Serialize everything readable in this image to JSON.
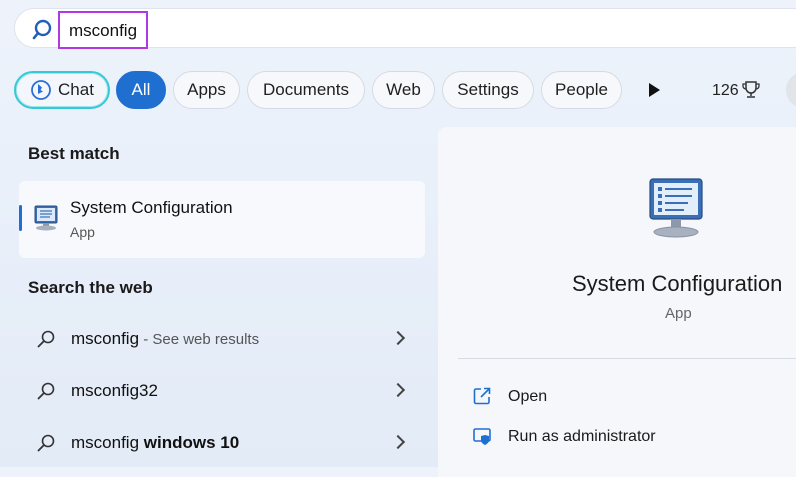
{
  "search": {
    "query": "msconfig"
  },
  "filters": {
    "chat": "Chat",
    "tabs": [
      "All",
      "Apps",
      "Documents",
      "Web",
      "Settings",
      "People"
    ],
    "active_tab": "All",
    "points": "126"
  },
  "best_match": {
    "heading": "Best match",
    "title": "System Configuration",
    "subtitle": "App"
  },
  "web": {
    "heading": "Search the web",
    "results": [
      {
        "query": "msconfig",
        "suffix": " - See web results"
      },
      {
        "query": "msconfig32",
        "suffix": ""
      },
      {
        "query": "msconfig",
        "bold": " windows 10"
      }
    ]
  },
  "detail": {
    "title": "System Configuration",
    "subtitle": "App",
    "actions": [
      "Open",
      "Run as administrator"
    ]
  },
  "colors": {
    "accent": "#1f6fd1",
    "highlight_box": "#b03ae0",
    "chat_ring": "#37c8d8"
  },
  "icons": [
    "search-icon",
    "bing-chat-icon",
    "play-icon",
    "trophy-icon",
    "system-configuration-icon",
    "open-external-icon",
    "shield-admin-icon",
    "chevron-right-icon"
  ]
}
